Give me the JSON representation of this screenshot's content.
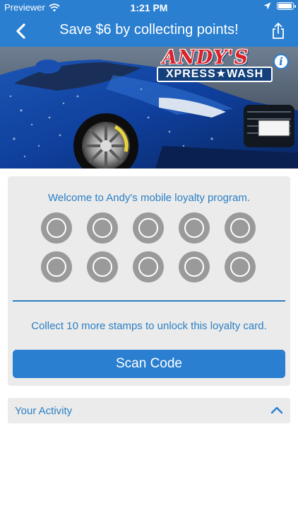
{
  "status_bar": {
    "carrier": "Previewer",
    "time": "1:21 PM",
    "battery_level": 1.0
  },
  "nav": {
    "title": "Save $6 by collecting points!",
    "back_icon": "chevron-left-icon",
    "share_icon": "share-icon"
  },
  "hero": {
    "logo_line1": "ANDY'S",
    "logo_line2": "XPRESS★WASH",
    "info_icon_glyph": "i"
  },
  "loyalty": {
    "welcome": "Welcome to Andy's mobile loyalty program.",
    "stamps_total": 10,
    "stamps_collected": 0,
    "collect_message": "Collect 10 more stamps to unlock this loyalty card.",
    "scan_button": "Scan Code"
  },
  "activity": {
    "label": "Your Activity",
    "expanded": true
  },
  "colors": {
    "accent": "#2a7fd0",
    "text_blue": "#2b7fc4",
    "card_bg": "#ebebeb",
    "stamp_gray": "#9a9a9a"
  }
}
